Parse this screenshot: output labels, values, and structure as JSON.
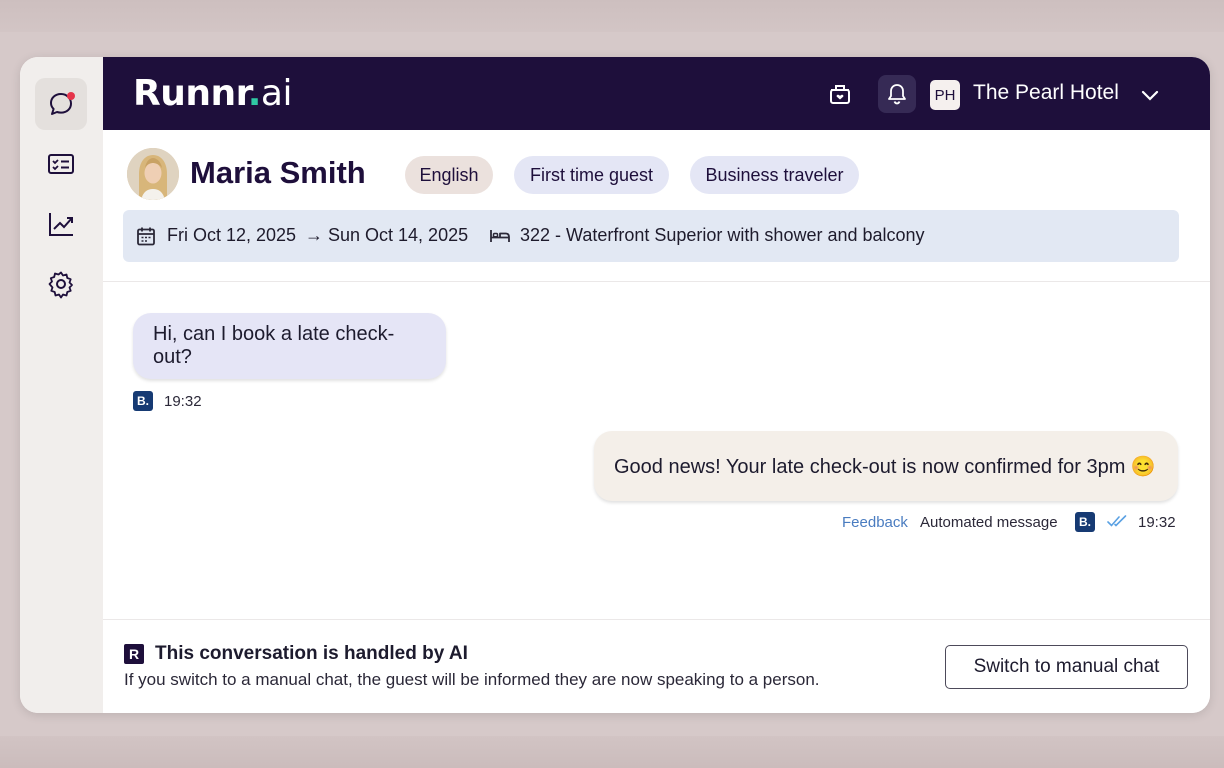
{
  "brand": {
    "logo_main": "Runnr",
    "logo_dot": ".",
    "logo_suffix": "ai"
  },
  "sidebar": {
    "items": [
      {
        "name": "conversations",
        "icon": "chat-bubble-icon",
        "active": true,
        "unread": true
      },
      {
        "name": "tasks",
        "icon": "checklist-icon",
        "active": false
      },
      {
        "name": "analytics",
        "icon": "trend-chart-icon",
        "active": false
      },
      {
        "name": "settings",
        "icon": "gear-icon",
        "active": false
      }
    ]
  },
  "topbar": {
    "hotel_initials": "PH",
    "hotel_name": "The Pearl Hotel",
    "icons": [
      "gift-box-icon",
      "bell-icon",
      "chevron-down-icon"
    ]
  },
  "guest": {
    "name": "Maria Smith",
    "tags": [
      "English",
      "First time guest",
      "Business traveler"
    ],
    "check_in": "Fri Oct 12, 2025",
    "arrow": "→",
    "check_out": "Sun Oct 14, 2025",
    "room": "322 - Waterfront Superior with shower and balcony"
  },
  "messages": [
    {
      "direction": "incoming",
      "text": "Hi, can I book a late check-out?",
      "channel_badge": "B.",
      "time": "19:32"
    },
    {
      "direction": "outgoing",
      "text": "Good news! Your late check-out is now confirmed for 3pm 😊",
      "feedback_label": "Feedback",
      "type_label": "Automated message",
      "channel_badge": "B.",
      "time": "19:32",
      "status": "read"
    }
  ],
  "footer": {
    "badge": "R",
    "title": "This conversation is handled by AI",
    "subtitle": "If you switch to a manual chat, the guest will be informed they are now speaking to a person.",
    "button_label": "Switch to manual chat"
  },
  "colors": {
    "topbar_bg": "#1e0f3b",
    "accent_teal": "#30c9a4",
    "incoming_bubble": "#e5e5f6",
    "outgoing_bubble": "#f4efe9",
    "unread_dot": "#e5344a"
  }
}
